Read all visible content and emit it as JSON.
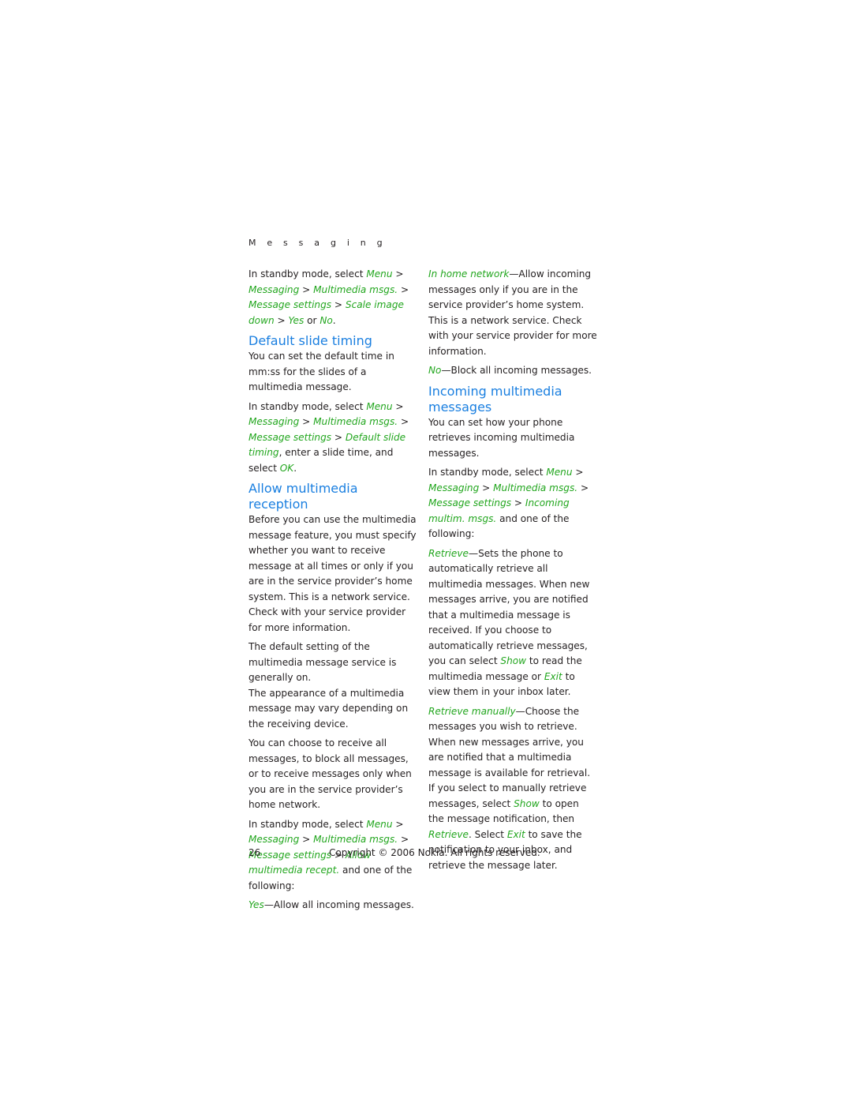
{
  "running_head": "M e s s a g i n g",
  "colors": {
    "heading": "#1a7fe0",
    "menu_path": "#22a61e",
    "body_text": "#231f20"
  },
  "left_column": {
    "intro": {
      "prefix": "In standby mode, select ",
      "menu": "Menu",
      "sep": " > ",
      "messaging": "Messaging",
      "mms": "Multimedia msgs.",
      "settings": "Message settings",
      "target": "Scale image down",
      "yes": "Yes",
      "or": " or ",
      "no": "No",
      "end": "."
    },
    "default_slide_timing": {
      "heading": "Default slide timing",
      "body": "You can set the default time in mm:ss for the slides of a multimedia message.",
      "path_prefix": "In standby mode, select ",
      "menu": "Menu",
      "messaging": "Messaging",
      "mms": "Multimedia msgs.",
      "settings": "Message settings",
      "target": "Default slide timing",
      "after": ", enter a slide time, and select ",
      "ok": "OK",
      "end": "."
    },
    "allow_reception": {
      "heading": "Allow multimedia reception",
      "body1": "Before you can use the multimedia message feature, you must specify whether you want to receive message at all times or only if you are in the service provider’s home system. This is a network service. Check with your service provider for more information.",
      "body2": "The default setting of the multimedia message service is generally on.",
      "body3": "The appearance of a multimedia message may vary depending on the receiving device.",
      "body4": "You can choose to receive all messages, to block all messages, or to receive messages only when you are in the service provider’s home network.",
      "path_prefix": "In standby mode, select ",
      "menu": "Menu",
      "messaging": "Messaging",
      "mms": "Multimedia msgs.",
      "settings": "Message settings",
      "target": "Allow multimedia recept.",
      "after": " and one of the following:",
      "option_yes_label": "Yes",
      "option_yes_desc": "—Allow all incoming messages."
    }
  },
  "right_column": {
    "option_home_label": "In home network",
    "option_home_desc": "—Allow incoming messages only if you are in the service provider’s home system. This is a network service. Check with your service provider for more information.",
    "option_no_label": "No",
    "option_no_desc": "—Block all incoming messages.",
    "incoming": {
      "heading": "Incoming multimedia messages",
      "body": "You can set how your phone retrieves incoming multimedia messages.",
      "path_prefix": "In standby mode, select ",
      "menu": "Menu",
      "messaging": "Messaging",
      "mms": "Multimedia msgs.",
      "settings": "Message settings",
      "target": "Incoming multim. msgs.",
      "after": " and one of the following:",
      "retrieve_label": "Retrieve",
      "retrieve_desc1": "—Sets the phone to automatically retrieve all multimedia messages. When new messages arrive, you are notified that a multimedia message is received. If you choose to automatically retrieve messages, you can select ",
      "show": "Show",
      "retrieve_desc2": " to read the multimedia message or ",
      "exit": "Exit",
      "retrieve_desc3": " to view them in your inbox later.",
      "manual_label": "Retrieve manually",
      "manual_desc1": "—Choose the messages you wish to retrieve. When new messages arrive, you are notified that a multimedia message is available for retrieval. If you select to manually retrieve messages, select ",
      "manual_show": "Show",
      "manual_desc2": " to open the message notification, then ",
      "manual_retrieve": "Retrieve",
      "manual_desc3": ". Select ",
      "manual_exit": "Exit",
      "manual_desc4": " to save the notification to your inbox, and retrieve the message later."
    }
  },
  "footer": {
    "page_number": "26",
    "copyright": "Copyright © 2006 Nokia. All rights reserved."
  }
}
